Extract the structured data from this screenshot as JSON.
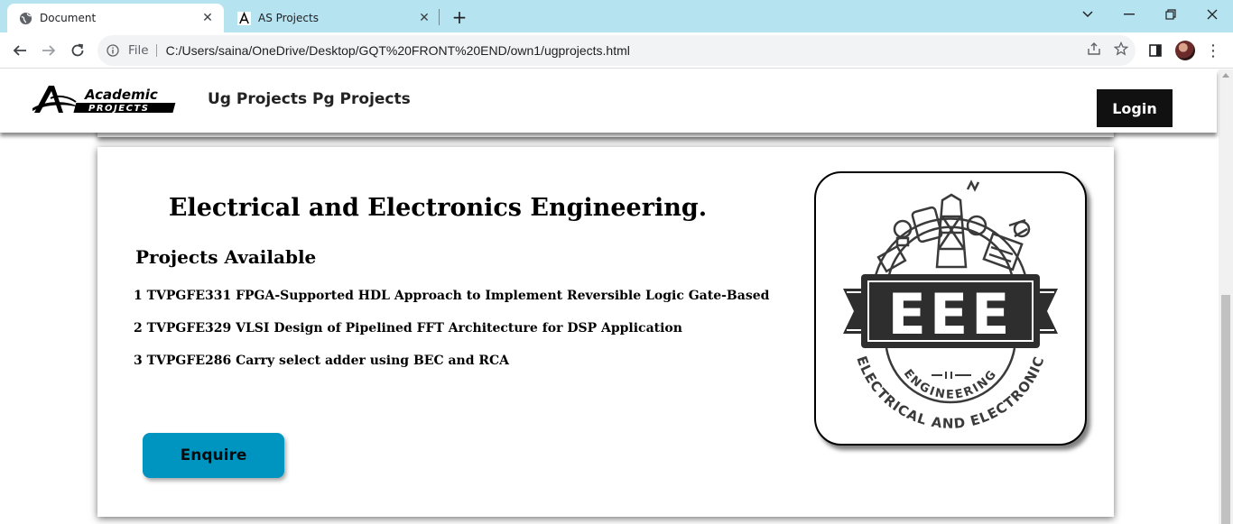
{
  "browser": {
    "tabs": [
      {
        "title": "Document",
        "icon": "globe-icon",
        "active": true
      },
      {
        "title": "AS Projects",
        "icon": "academic-logo-icon",
        "active": false
      }
    ],
    "address": {
      "scheme_label": "File",
      "url": "C:/Users/saina/OneDrive/Desktop/GQT%20FRONT%20END/own1/ugprojects.html"
    }
  },
  "site": {
    "logo_text": "Academic",
    "logo_subtext": "PROJECTS",
    "nav": [
      {
        "label": "Ug Projects"
      },
      {
        "label": "Pg Projects"
      }
    ],
    "login_label": "Login"
  },
  "card": {
    "title": "Electrical and Electronics Engineering.",
    "subheading": "Projects Available",
    "projects": [
      "1 TVPGFE331 FPGA-Supported HDL Approach to Implement Reversible Logic Gate-Based",
      "2 TVPGFE329 VLSI Design of Pipelined FFT Architecture for DSP Application",
      "3 TVPGFE286 Carry select adder using BEC and RCA"
    ],
    "enquire_label": "Enquire",
    "image": {
      "badge_text": "EEE",
      "ribbon_text": "ENGINEERING",
      "arc_text": "ELECTRICAL AND ELECTRONIC"
    }
  },
  "colors": {
    "tabbar": "#b6e3f0",
    "enquire_button": "#0095c0",
    "login_button": "#111111"
  }
}
